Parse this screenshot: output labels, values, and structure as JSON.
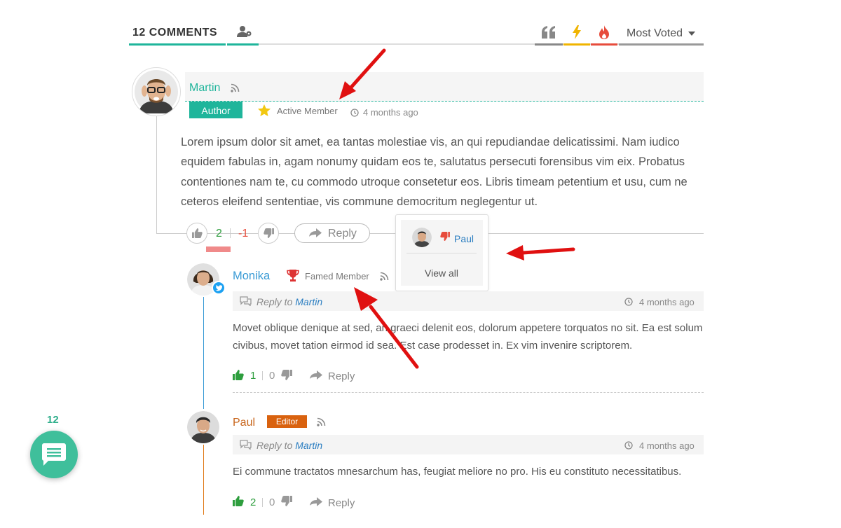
{
  "header": {
    "comments_count_label": "12 COMMENTS",
    "sort_selected": "Most Voted",
    "accent": "#1fb59b"
  },
  "comments": [
    {
      "author": "Martin",
      "badge": "Author",
      "rank": "Active Member",
      "time": "4 months ago",
      "body": "Lorem ipsum dolor sit amet, ea tantas molestiae vis, an qui repudiandae delicatissimi. Nam iudico equidem fabulas in, agam nonumy quidam eos te, salutatus persecuti forensibus vim eix. Probatus contentiones nam te, cu commodo utroque consetetur eos. Libris timeam petentium et usu, cum ne ceteros eleifend sententiae, vis commune democritum neglegentur ut.",
      "upvotes": "2",
      "downvotes": "-1",
      "reply_label": "Reply"
    }
  ],
  "voters_popup": {
    "voter_name": "Paul",
    "view_all_label": "View all"
  },
  "replies": [
    {
      "author": "Monika",
      "rank": "Famed Member",
      "reply_to_prefix": "Reply to",
      "reply_to_name": "Martin",
      "time": "4 months ago",
      "body": "Movet oblique denique at sed, an graeci delenit eos, dolorum appetere torquatos no sit. Ea est solum civibus, movet tation eirmod id sea. Est case prodesset in. Ex vim invenire scriptorem.",
      "upvotes": "1",
      "downvotes": "0",
      "reply_label": "Reply"
    },
    {
      "author": "Paul",
      "badge": "Editor",
      "reply_to_prefix": "Reply to",
      "reply_to_name": "Martin",
      "time": "4 months ago",
      "body": "Ei commune tractatos mnesarchum has, feugiat meliore no pro. His eu constituto necessitatibus.",
      "upvotes": "2",
      "downvotes": "0",
      "reply_label": "Reply"
    }
  ],
  "floating_button": {
    "count": "12"
  }
}
